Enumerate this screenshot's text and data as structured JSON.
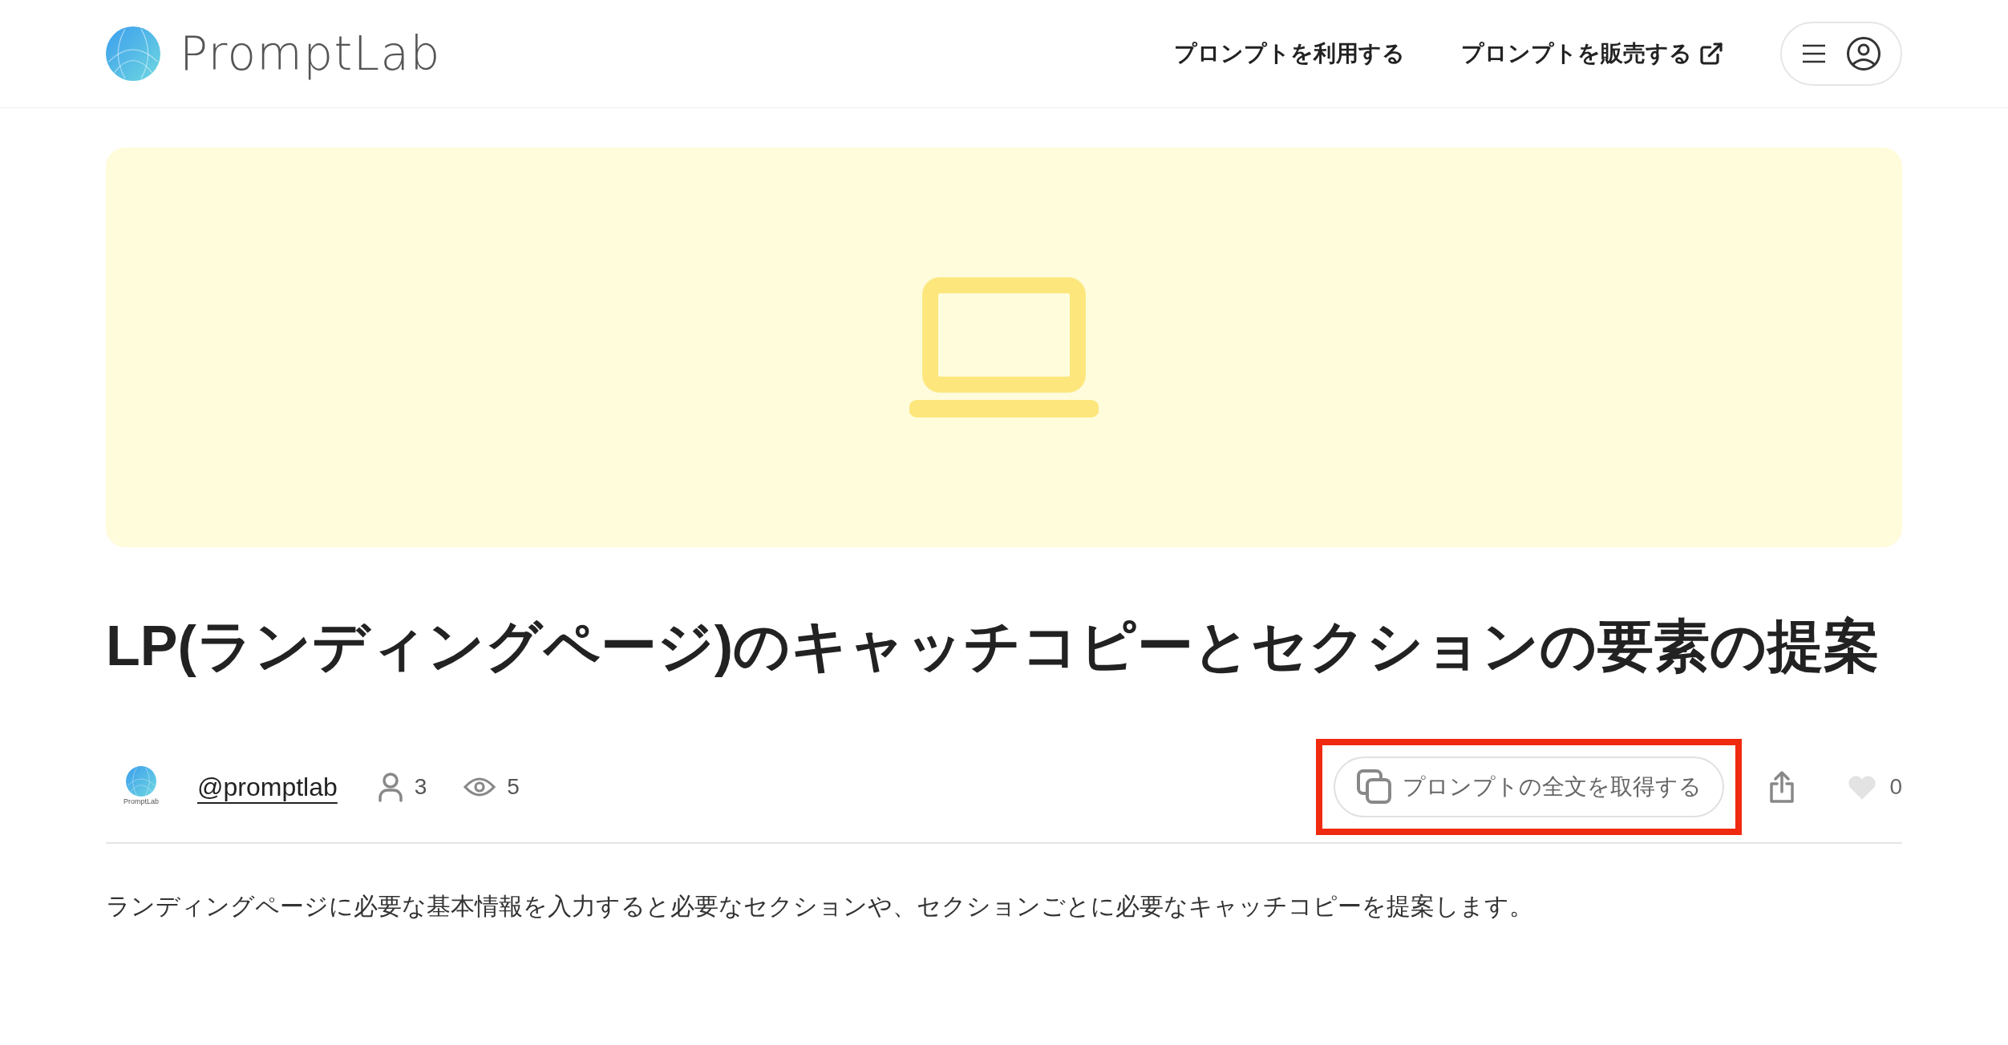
{
  "header": {
    "logo_text": "PromptLab",
    "nav": [
      {
        "label": "プロンプトを利用する",
        "external": false
      },
      {
        "label": "プロンプトを販売する",
        "external": true
      }
    ]
  },
  "title": "LP(ランディングページ)のキャッチコピーとセクションの要素の提案",
  "meta": {
    "avatar_caption": "PromptLab",
    "author": "@promptlab",
    "users": "3",
    "views": "5"
  },
  "copy_button": {
    "label": "プロンプトの全文を取得する",
    "highlighted": true
  },
  "like": {
    "liked": false,
    "count": "0"
  },
  "description": "ランディングページに必要な基本情報を入力すると必要なセクションや、セクションごとに必要なキャッチコピーを提案します。"
}
